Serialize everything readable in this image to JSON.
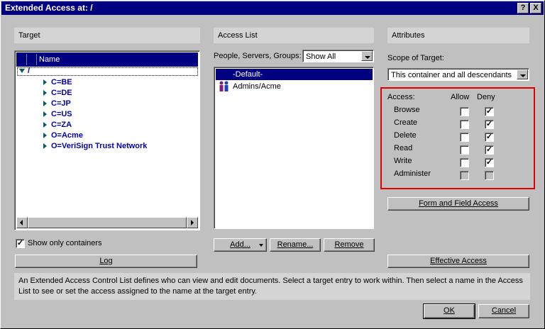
{
  "window": {
    "title": "Extended Access at: /",
    "help_btn": "?",
    "close_btn": "X"
  },
  "target": {
    "header": "Target",
    "column_name": "Name",
    "root": "/",
    "entries": [
      "C=BE",
      "C=DE",
      "C=JP",
      "C=US",
      "C=ZA",
      "O=Acme",
      "O=VeriSign Trust Network"
    ],
    "show_only_containers_label": "Show only containers",
    "show_only_containers_checked": true,
    "log_button": "Log"
  },
  "access_list": {
    "header": "Access List",
    "filter_label": "People, Servers, Groups:",
    "filter_value": "Show All",
    "entries": [
      "-Default-",
      "Admins/Acme"
    ],
    "add_button": "Add...",
    "rename_button": "Rename...",
    "remove_button": "Remove"
  },
  "attributes": {
    "header": "Attributes",
    "scope_label": "Scope of Target:",
    "scope_value": "This container and all descendants",
    "access_label": "Access:",
    "allow_label": "Allow",
    "deny_label": "Deny",
    "rights": [
      {
        "name": "Browse",
        "allow": false,
        "deny": true
      },
      {
        "name": "Create",
        "allow": false,
        "deny": true
      },
      {
        "name": "Delete",
        "allow": false,
        "deny": true
      },
      {
        "name": "Read",
        "allow": false,
        "deny": true
      },
      {
        "name": "Write",
        "allow": false,
        "deny": true
      },
      {
        "name": "Administer",
        "allow": false,
        "deny": false
      }
    ],
    "form_field_button": "Form and Field Access",
    "effective_access_button": "Effective Access",
    "highlight_color": "#e00000"
  },
  "description": "An Extended Access Control List defines who can view and edit documents.  Select a target entry to work within.  Then select a name in the Access List to see or set the access assigned to the name at the target entry.",
  "footer": {
    "ok_button": "OK",
    "cancel_button": "Cancel"
  },
  "colors": {
    "titlebar": "#000080",
    "selection": "#000080",
    "tree_text": "#0000b0"
  }
}
